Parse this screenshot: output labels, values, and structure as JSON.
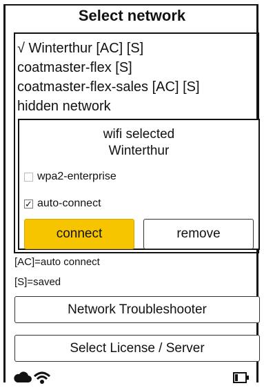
{
  "header": {
    "title": "Select network"
  },
  "networks": [
    {
      "label": "√ Winterthur [AC] [S]"
    },
    {
      "label": "coatmaster-flex [S]"
    },
    {
      "label": "coatmaster-flex-sales [AC] [S]"
    },
    {
      "label": "hidden network"
    }
  ],
  "dialog": {
    "title": "wifi selected",
    "network_name": "Winterthur",
    "options": [
      {
        "label": "wpa2-enterprise",
        "checked": false,
        "mark": ""
      },
      {
        "label": "auto-connect",
        "checked": true,
        "mark": "✓"
      }
    ],
    "connect_label": "connect",
    "remove_label": "remove",
    "accent_color": "#f7c400"
  },
  "legend": {
    "ac": "[AC]=auto connect",
    "s": "[S]=saved"
  },
  "buttons": {
    "troubleshooter": "Network Troubleshooter",
    "license": "Select License / Server"
  },
  "status_bar": {
    "icons": [
      "cloud-icon",
      "wifi-icon",
      "battery-icon"
    ]
  }
}
